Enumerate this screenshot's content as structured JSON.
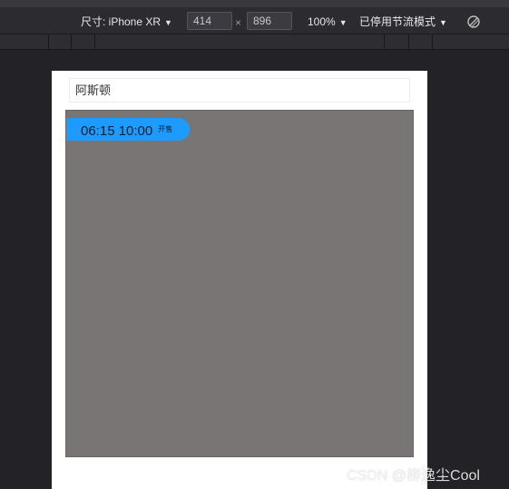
{
  "toolbar": {
    "size_label": "尺寸: iPhone XR",
    "width_value": "414",
    "times": "×",
    "height_value": "896",
    "zoom": "100%",
    "throttle": "已停用节流模式",
    "caret": "▼",
    "rotate_icon": "rotate-icon"
  },
  "page": {
    "search_value": "阿斯顿",
    "time_pill": {
      "time": "06:15 10:00",
      "tag": "开售"
    }
  },
  "watermark": "CSDN @柳逸尘Cool",
  "colors": {
    "pill": "#1e9bff",
    "map_gray": "#797574",
    "toolbar_bg": "#2b2b30"
  }
}
